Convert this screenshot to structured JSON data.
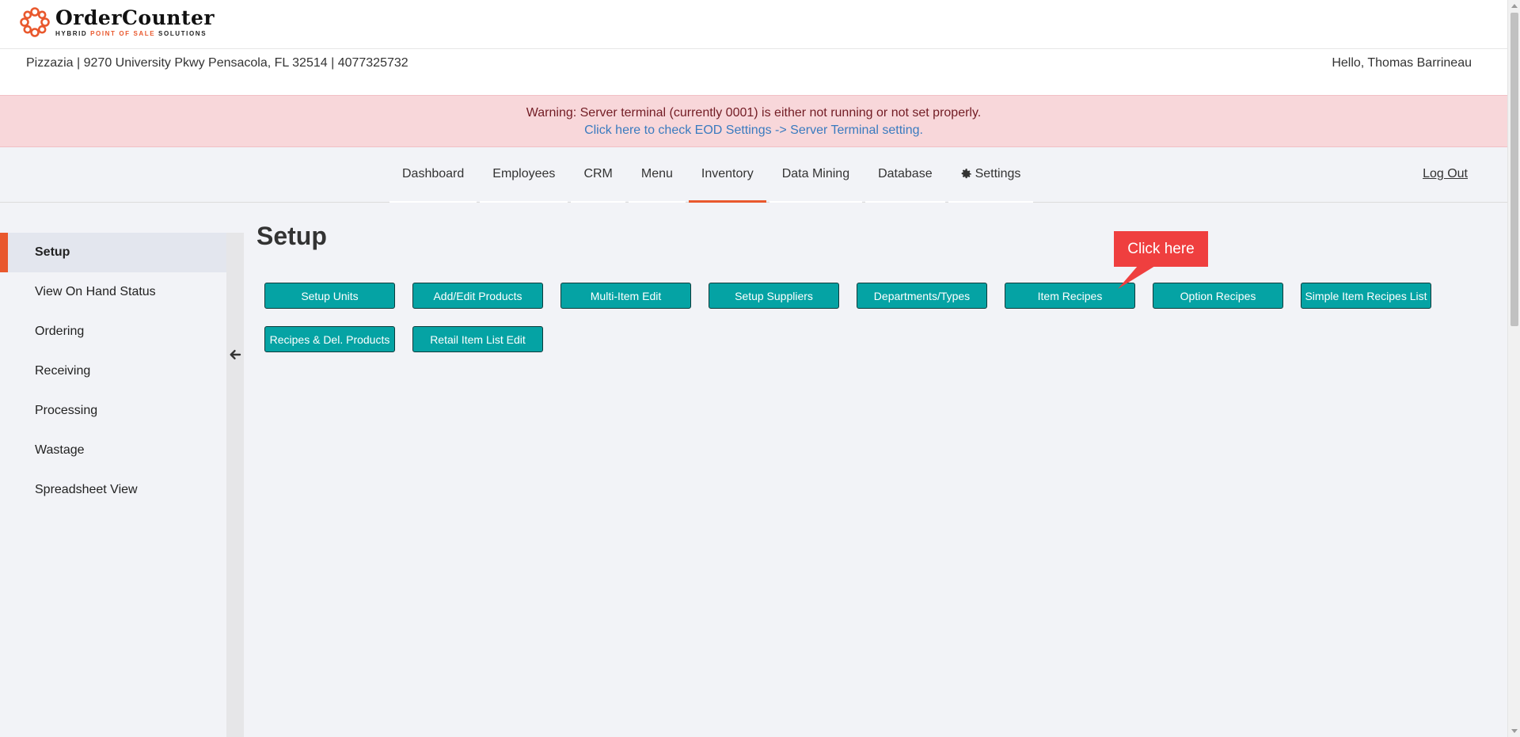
{
  "brand": {
    "name_first": "Order",
    "name_second": "Counter",
    "tagline_part1": "HYBRID ",
    "tagline_accent": "POINT OF SALE",
    "tagline_part2": " SOLUTIONS",
    "accent_color": "#e9582d"
  },
  "header": {
    "store_info": "Pizzazia | 9270 University Pkwy Pensacola, FL 32514 | 4077325732",
    "greeting": "Hello, Thomas Barrineau"
  },
  "warning": {
    "message": "Warning: Server terminal (currently 0001) is either not running or not set properly.",
    "link_text": "Click here to check EOD Settings -> Server Terminal setting."
  },
  "nav": {
    "items": [
      {
        "label": "Dashboard"
      },
      {
        "label": "Employees"
      },
      {
        "label": "CRM"
      },
      {
        "label": "Menu"
      },
      {
        "label": "Inventory",
        "active": true
      },
      {
        "label": "Data Mining"
      },
      {
        "label": "Database"
      },
      {
        "label": "Settings",
        "icon": "gear-icon"
      }
    ],
    "logout": "Log Out"
  },
  "sidebar": {
    "items": [
      {
        "label": "Setup",
        "active": true
      },
      {
        "label": "View On Hand Status"
      },
      {
        "label": "Ordering"
      },
      {
        "label": "Receiving"
      },
      {
        "label": "Processing"
      },
      {
        "label": "Wastage"
      },
      {
        "label": "Spreadsheet View"
      }
    ],
    "collapse_icon": "arrow-left-icon"
  },
  "main": {
    "title": "Setup",
    "buttons": [
      {
        "label": "Setup Units"
      },
      {
        "label": "Add/Edit Products"
      },
      {
        "label": "Multi-Item Edit"
      },
      {
        "label": "Setup Suppliers"
      },
      {
        "label": "Departments/Types"
      },
      {
        "label": "Item Recipes"
      },
      {
        "label": "Option Recipes"
      },
      {
        "label": "Simple Item Recipes List"
      },
      {
        "label": "Recipes & Del. Products"
      },
      {
        "label": "Retail Item List Edit"
      }
    ],
    "button_color": "#05a3a4"
  },
  "callout": {
    "text": "Click here",
    "color": "#ef3f3f"
  }
}
